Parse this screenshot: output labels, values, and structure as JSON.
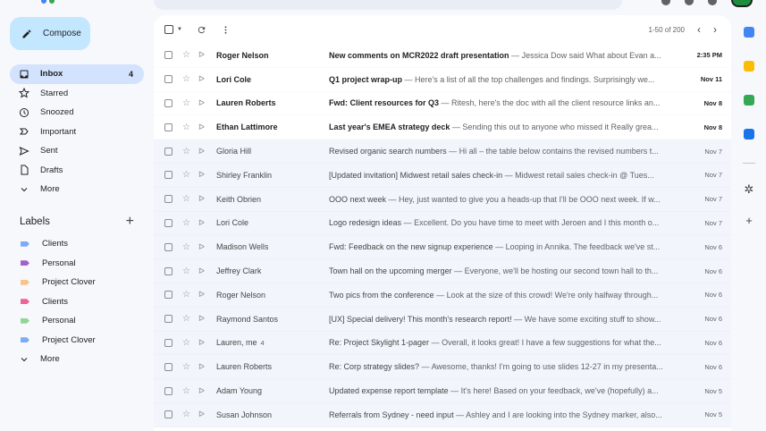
{
  "colors": {
    "accent": "#c2e7ff",
    "active_nav": "#d3e3fd",
    "read_row": "#f2f6fc",
    "surface": "#f6f8fc"
  },
  "compose": {
    "label": "Compose",
    "icon": "pencil-icon"
  },
  "nav": [
    {
      "name": "inbox",
      "label": "Inbox",
      "count": "4",
      "icon": "inbox-icon",
      "active": true
    },
    {
      "name": "starred",
      "label": "Starred",
      "count": "",
      "icon": "star-icon"
    },
    {
      "name": "snoozed",
      "label": "Snoozed",
      "count": "",
      "icon": "clock-icon"
    },
    {
      "name": "important",
      "label": "Important",
      "count": "",
      "icon": "important-icon"
    },
    {
      "name": "sent",
      "label": "Sent",
      "count": "",
      "icon": "send-icon"
    },
    {
      "name": "drafts",
      "label": "Drafts",
      "count": "",
      "icon": "draft-icon"
    },
    {
      "name": "more",
      "label": "More",
      "count": "",
      "icon": "chevron-down-icon"
    }
  ],
  "labels_section": {
    "title": "Labels",
    "items": [
      {
        "label": "Clients",
        "color": "#7baaf7"
      },
      {
        "label": "Personal",
        "color": "#a163c9"
      },
      {
        "label": "Project Clover",
        "color": "#f8c48b"
      },
      {
        "label": "Clients",
        "color": "#f06292"
      },
      {
        "label": "Personal",
        "color": "#94d494"
      },
      {
        "label": "Project Clover",
        "color": "#7baaf7"
      }
    ],
    "more": "More"
  },
  "toolbar": {
    "pagination": "1-50 of 200"
  },
  "emails": [
    {
      "sender": "Roger Nelson",
      "count": "",
      "subject": "New comments on MCR2022 draft presentation",
      "snippet": "Jessica Dow said What about Evan a...",
      "date": "2:35 PM",
      "unread": true
    },
    {
      "sender": "Lori Cole",
      "count": "",
      "subject": "Q1 project wrap-up",
      "snippet": "Here's a list of all the top challenges and findings. Surprisingly we...",
      "date": "Nov 11",
      "unread": true
    },
    {
      "sender": "Lauren Roberts",
      "count": "",
      "subject": "Fwd: Client resources for Q3",
      "snippet": "Ritesh, here's the doc with all the client resource links an...",
      "date": "Nov 8",
      "unread": true
    },
    {
      "sender": "Ethan Lattimore",
      "count": "",
      "subject": "Last year's EMEA strategy deck",
      "snippet": "Sending this out to anyone who missed it Really grea...",
      "date": "Nov 8",
      "unread": true
    },
    {
      "sender": "Gloria Hill",
      "count": "",
      "subject": "Revised organic search numbers",
      "snippet": "Hi all – the table below contains the revised numbers t...",
      "date": "Nov 7",
      "unread": false
    },
    {
      "sender": "Shirley Franklin",
      "count": "",
      "subject": "[Updated invitation] Midwest retail sales check-in",
      "snippet": "Midwest retail sales check-in @ Tues...",
      "date": "Nov 7",
      "unread": false
    },
    {
      "sender": "Keith Obrien",
      "count": "",
      "subject": "OOO next week",
      "snippet": "Hey, just wanted to give you a heads-up that I'll be OOO next week. If w...",
      "date": "Nov 7",
      "unread": false
    },
    {
      "sender": "Lori Cole",
      "count": "",
      "subject": "Logo redesign ideas",
      "snippet": "Excellent. Do you have time to meet with Jeroen and I this month o...",
      "date": "Nov 7",
      "unread": false
    },
    {
      "sender": "Madison Wells",
      "count": "",
      "subject": "Fwd: Feedback on the new signup experience",
      "snippet": "Looping in Annika. The feedback we've st...",
      "date": "Nov 6",
      "unread": false
    },
    {
      "sender": "Jeffrey Clark",
      "count": "",
      "subject": "Town hall on the upcoming merger",
      "snippet": "Everyone, we'll be hosting our second town hall to th...",
      "date": "Nov 6",
      "unread": false
    },
    {
      "sender": "Roger Nelson",
      "count": "",
      "subject": "Two pics from the conference",
      "snippet": "Look at the size of this crowd! We're only halfway through...",
      "date": "Nov 6",
      "unread": false
    },
    {
      "sender": "Raymond Santos",
      "count": "",
      "subject": "[UX] Special delivery! This month's research report!",
      "snippet": "We have some exciting stuff to show...",
      "date": "Nov 6",
      "unread": false
    },
    {
      "sender": "Lauren, me",
      "count": "4",
      "subject": "Re: Project Skylight 1-pager",
      "snippet": "Overall, it looks great! I have a few suggestions for what the...",
      "date": "Nov 6",
      "unread": false
    },
    {
      "sender": "Lauren Roberts",
      "count": "",
      "subject": "Re: Corp strategy slides?",
      "snippet": "Awesome, thanks! I'm going to use slides 12-27 in my presenta...",
      "date": "Nov 6",
      "unread": false
    },
    {
      "sender": "Adam Young",
      "count": "",
      "subject": "Updated expense report template",
      "snippet": "It's here! Based on your feedback, we've (hopefully) a...",
      "date": "Nov 5",
      "unread": false
    },
    {
      "sender": "Susan Johnson",
      "count": "",
      "subject": "Referrals from Sydney - need input",
      "snippet": "Ashley and I are looking into the Sydney marker, also...",
      "date": "Nov 5",
      "unread": false
    }
  ],
  "side_apps": [
    {
      "name": "calendar-app",
      "color": "#4285f4"
    },
    {
      "name": "keep-app",
      "color": "#fbbc04"
    },
    {
      "name": "contacts-app",
      "color": "#34a853"
    },
    {
      "name": "tasks-app",
      "color": "#1a73e8"
    }
  ]
}
